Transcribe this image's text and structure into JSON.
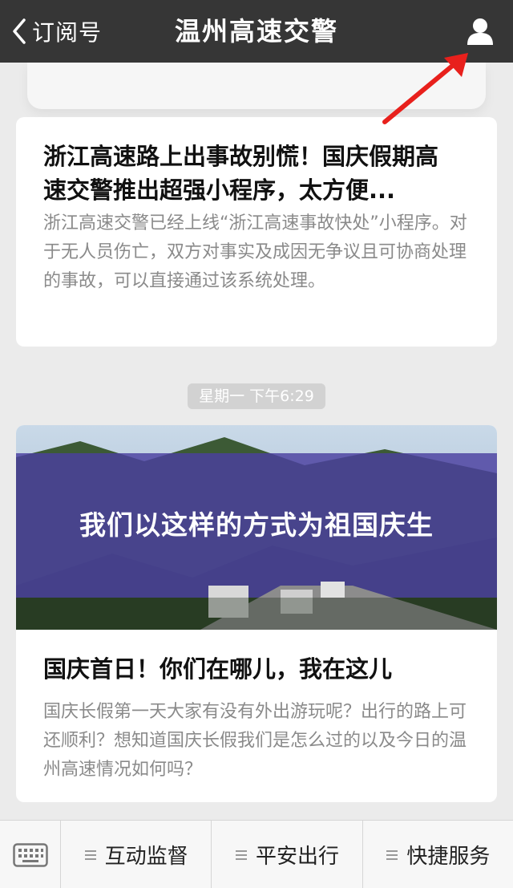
{
  "header": {
    "back_label": "订阅号",
    "title": "温州高速交警",
    "back_icon": "chevron-left-icon",
    "profile_icon": "person-icon"
  },
  "article1": {
    "title": "浙江高速路上出事故别慌！国庆假期高速交警推出超强小程序，太方便...",
    "description": "浙江高速交警已经上线“浙江高速事故快处”小程序。对于无人员伤亡，双方对事实及成因无争议且可协商处理的事故，可以直接通过该系统处理。"
  },
  "timestamp": "星期一 下午6:29",
  "article2": {
    "cover_text": "我们以这样的方式为祖国庆生",
    "title": "国庆首日！你们在哪儿，我在这儿",
    "description": "国庆长假第一天大家有没有外出游玩呢？出行的路上可还顺利？想知道国庆长假我们是怎么过的以及今日的温州高速情况如何吗？"
  },
  "menu": {
    "keyboard_icon": "keyboard-icon",
    "items": [
      {
        "label": "互动监督"
      },
      {
        "label": "平安出行"
      },
      {
        "label": "快捷服务"
      }
    ]
  },
  "colors": {
    "navbar": "#363636",
    "background": "#ebebeb",
    "annotation_arrow": "#e8201c",
    "cover_band": "#4b3fa0"
  }
}
